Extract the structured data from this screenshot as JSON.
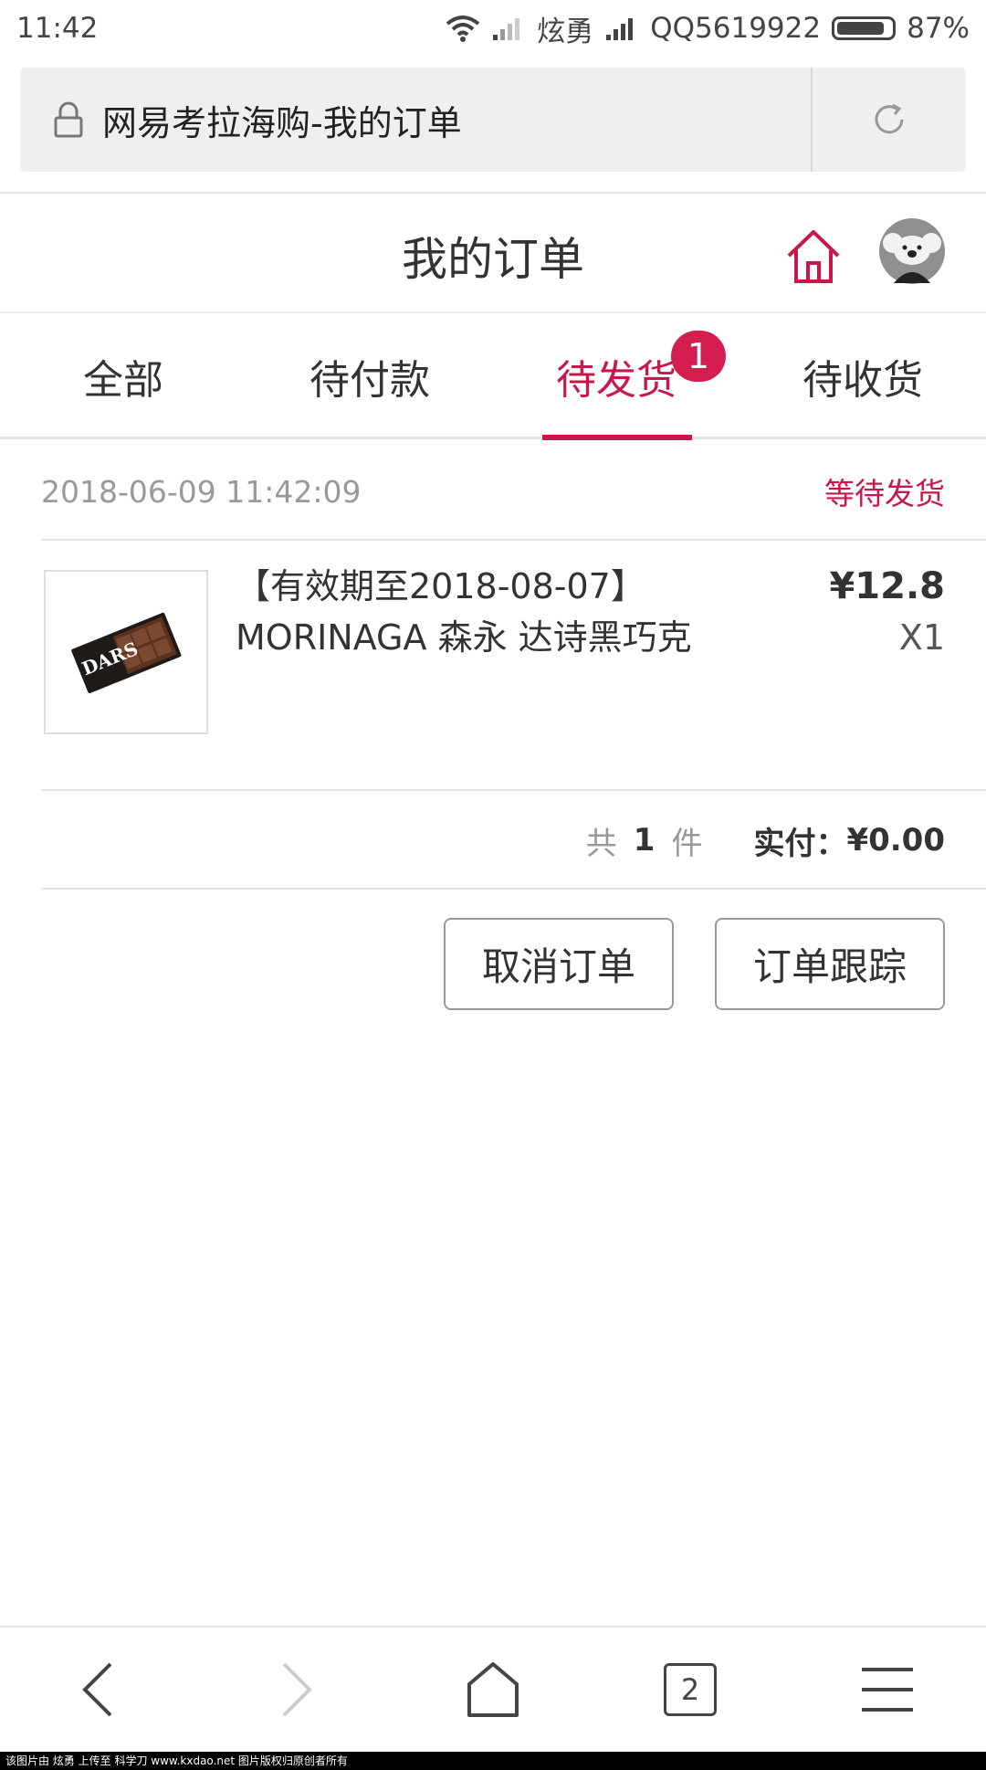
{
  "status_bar": {
    "time": "11:42",
    "carrier1": "炫勇",
    "carrier2": "QQ5619922",
    "battery": "87%",
    "battery_level": 0.87
  },
  "browser": {
    "page_title": "网易考拉海购-我的订单"
  },
  "header": {
    "title": "我的订单",
    "accent_color": "#c8174a"
  },
  "tabs": [
    {
      "label": "全部"
    },
    {
      "label": "待付款"
    },
    {
      "label": "待发货",
      "active": true,
      "badge": "1"
    },
    {
      "label": "待收货"
    }
  ],
  "order": {
    "time": "2018-06-09 11:42:09",
    "status": "等待发货",
    "product": {
      "name_line1": "【有效期至2018-08-07】",
      "name_line2": "MORINAGA 森永 达诗黑巧克",
      "price": "¥12.8",
      "quantity": "X1",
      "thumb_brand": "DARS"
    },
    "summary": {
      "count_prefix": "共",
      "count": "1",
      "count_suffix": "件",
      "paid_label": "实付：",
      "paid_amount": "¥0.00"
    },
    "actions": {
      "cancel": "取消订单",
      "track": "订单跟踪"
    }
  },
  "bottom_nav": {
    "tab_count": "2"
  },
  "watermark": "该图片由 炫勇 上传至 科学刀 www.kxdao.net 图片版权归原创者所有"
}
